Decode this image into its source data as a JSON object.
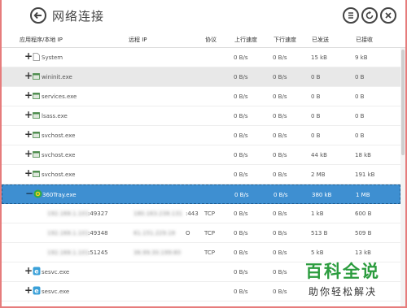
{
  "window": {
    "title": "网络连接"
  },
  "columns": {
    "app": "应用程序/本地 IP",
    "remote": "远程 IP",
    "protocol": "协议",
    "up": "上行速度",
    "down": "下行速度",
    "sent": "已发送",
    "recv": "已接收"
  },
  "rows": [
    {
      "name": "System",
      "remote": "",
      "protocol": "",
      "up": "0 B/s",
      "down": "0 B/s",
      "sent": "15 kB",
      "recv": "9 kB",
      "expander": "+",
      "icon": "file-icon"
    },
    {
      "name": "wininit.exe",
      "remote": "",
      "protocol": "",
      "up": "0 B/s",
      "down": "0 B/s",
      "sent": "0 B",
      "recv": "0 B",
      "expander": "+",
      "icon": "window-icon"
    },
    {
      "name": "services.exe",
      "remote": "",
      "protocol": "",
      "up": "0 B/s",
      "down": "0 B/s",
      "sent": "0 B",
      "recv": "0 B",
      "expander": "+",
      "icon": "window-icon"
    },
    {
      "name": "lsass.exe",
      "remote": "",
      "protocol": "",
      "up": "0 B/s",
      "down": "0 B/s",
      "sent": "0 B",
      "recv": "0 B",
      "expander": "+",
      "icon": "window-icon"
    },
    {
      "name": "svchost.exe",
      "remote": "",
      "protocol": "",
      "up": "0 B/s",
      "down": "0 B/s",
      "sent": "0 B",
      "recv": "0 B",
      "expander": "+",
      "icon": "window-icon"
    },
    {
      "name": "svchost.exe",
      "remote": "",
      "protocol": "",
      "up": "0 B/s",
      "down": "0 B/s",
      "sent": "44 kB",
      "recv": "18 kB",
      "expander": "+",
      "icon": "window-icon"
    },
    {
      "name": "svchost.exe",
      "remote": "",
      "protocol": "",
      "up": "0 B/s",
      "down": "0 B/s",
      "sent": "2 MB",
      "recv": "191 kB",
      "expander": "+",
      "icon": "window-icon"
    },
    {
      "name": "360Tray.exe",
      "remote": "",
      "protocol": "",
      "up": "0 B/s",
      "down": "0 B/s",
      "sent": "380 kB",
      "recv": "1 MB",
      "expander": "−",
      "icon": "360-icon"
    },
    {
      "name": ":49327",
      "remote": ":443",
      "protocol": "TCP",
      "up": "0 B/s",
      "down": "0 B/s",
      "sent": "1 kB",
      "recv": "600 B",
      "expander": "",
      "icon": ""
    },
    {
      "name": ":49348",
      "remote": "O",
      "protocol": "TCP",
      "up": "0 B/s",
      "down": "0 B/s",
      "sent": "513 B",
      "recv": "509 B",
      "expander": "",
      "icon": ""
    },
    {
      "name": ":51245",
      "remote": "",
      "protocol": "TCP",
      "up": "0 B/s",
      "down": "0 B/s",
      "sent": "5 kB",
      "recv": "13 kB",
      "expander": "",
      "icon": ""
    },
    {
      "name": "sesvc.exe",
      "remote": "",
      "protocol": "",
      "up": "0 B/s",
      "down": "0 B/s",
      "sent": "",
      "recv": "",
      "expander": "+",
      "icon": "e-icon"
    },
    {
      "name": "sesvc.exe",
      "remote": "",
      "protocol": "",
      "up": "0 B/s",
      "down": "0 B/s",
      "sent": "",
      "recv": "",
      "expander": "+",
      "icon": "e-icon"
    }
  ],
  "watermark": {
    "title": "百科全说",
    "subtitle": "助你轻松解决"
  },
  "colors": {
    "selected": "#3e8fd1",
    "alt_row": "#e8e8e8",
    "frame": "#e67c7c",
    "watermark": "#2b9c3e"
  }
}
